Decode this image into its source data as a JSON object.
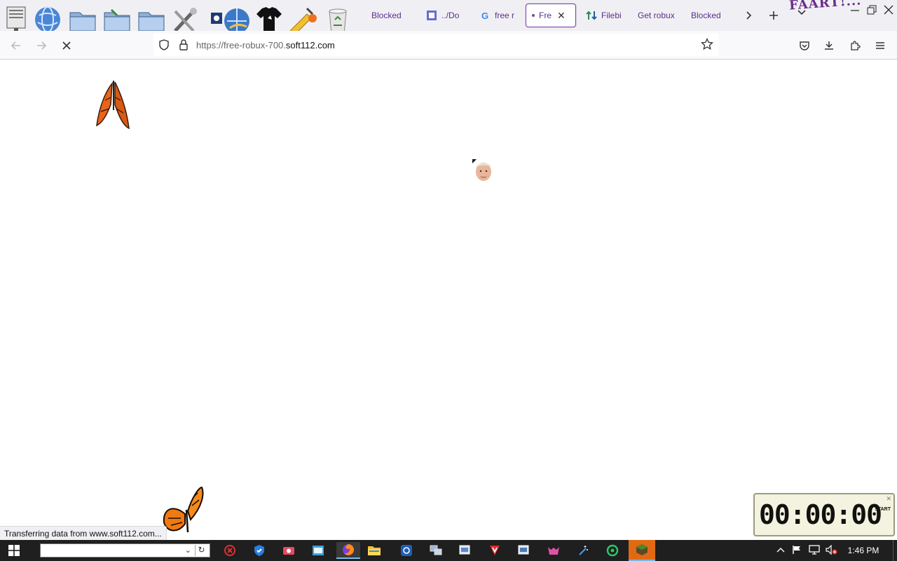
{
  "tabs": [
    {
      "label": "Blocked"
    },
    {
      "label": "../Do"
    },
    {
      "label": "free r"
    },
    {
      "label": "Fre",
      "active": true
    },
    {
      "label": "Filebi"
    },
    {
      "label": "Get robux"
    },
    {
      "label": "Blocked"
    }
  ],
  "overlay": {
    "brand_text": "FAART!..."
  },
  "address_bar": {
    "url_prefix": "https://free-robux-700.",
    "url_domain": "soft112.com"
  },
  "status_text": "Transferring data from www.soft112.com...",
  "timer": {
    "display": "00:00:00",
    "start_label": "START"
  },
  "taskbar": {
    "time": "1:46 PM"
  },
  "colors": {
    "tab_text": "#5b2e8a",
    "active_tab_border": "#7a3fb6",
    "taskbar_bg": "#1f1f1f",
    "timer_bg": "#f3f3df"
  }
}
